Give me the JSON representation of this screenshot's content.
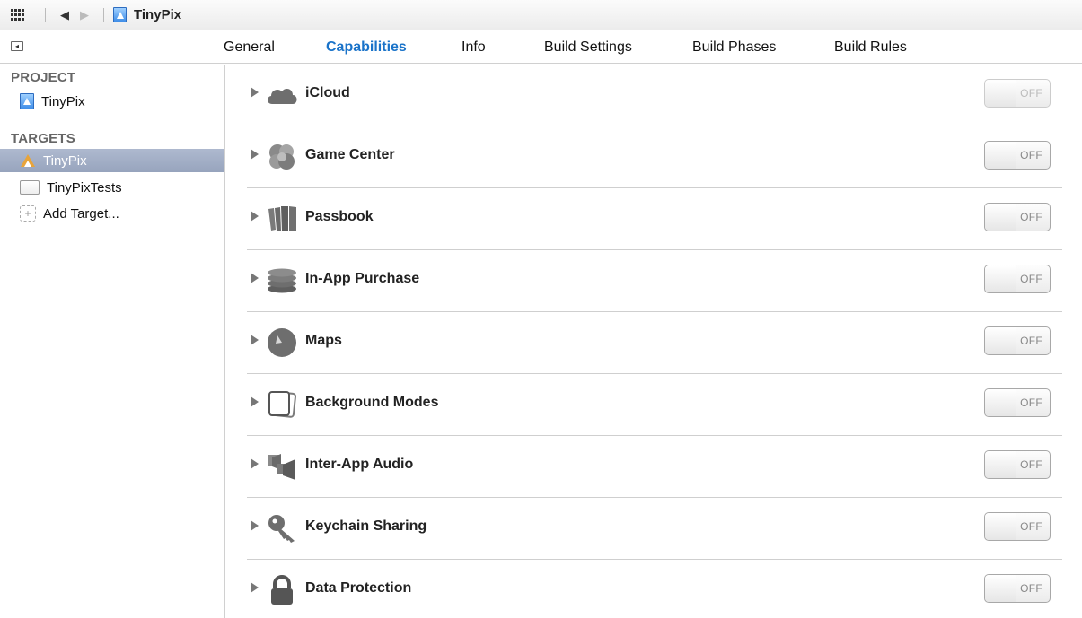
{
  "jumpbar": {
    "back_icon": "back-arrow-icon",
    "forward_icon": "forward-arrow-icon",
    "project_name": "TinyPix"
  },
  "tabs": [
    {
      "label": "General",
      "active": false
    },
    {
      "label": "Capabilities",
      "active": true
    },
    {
      "label": "Info",
      "active": false
    },
    {
      "label": "Build Settings",
      "active": false
    },
    {
      "label": "Build Phases",
      "active": false
    },
    {
      "label": "Build Rules",
      "active": false
    }
  ],
  "sidebar": {
    "project_header": "PROJECT",
    "project_item": "TinyPix",
    "targets_header": "TARGETS",
    "targets": [
      {
        "label": "TinyPix",
        "selected": true
      },
      {
        "label": "TinyPixTests",
        "selected": false
      }
    ],
    "add_target": "Add Target..."
  },
  "capabilities": [
    {
      "label": "iCloud",
      "icon": "cloud-icon",
      "state": "OFF"
    },
    {
      "label": "Game Center",
      "icon": "game-center-icon",
      "state": "OFF"
    },
    {
      "label": "Passbook",
      "icon": "passbook-icon",
      "state": "OFF"
    },
    {
      "label": "In-App Purchase",
      "icon": "coins-icon",
      "state": "OFF"
    },
    {
      "label": "Maps",
      "icon": "compass-icon",
      "state": "OFF"
    },
    {
      "label": "Background Modes",
      "icon": "background-modes-icon",
      "state": "OFF"
    },
    {
      "label": "Inter-App Audio",
      "icon": "speaker-icon",
      "state": "OFF"
    },
    {
      "label": "Keychain Sharing",
      "icon": "key-icon",
      "state": "OFF"
    },
    {
      "label": "Data Protection",
      "icon": "lock-icon",
      "state": "OFF"
    }
  ],
  "colors": {
    "accent_tab": "#1a73c9",
    "selection": "#9ba8c0",
    "icon_gray": "#6e6e6e"
  }
}
